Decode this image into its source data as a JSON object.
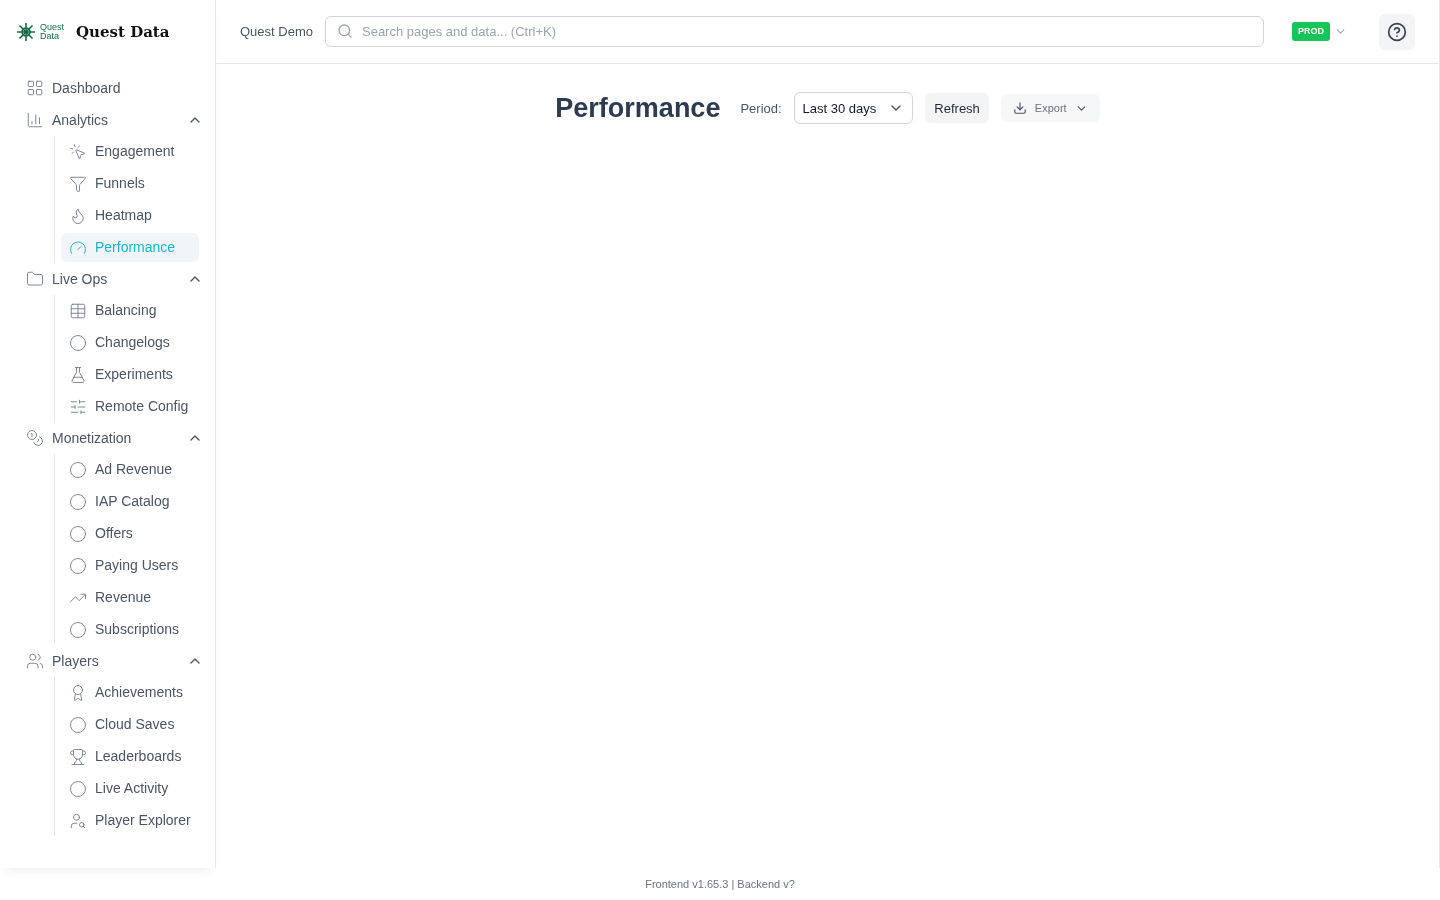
{
  "brand": {
    "logo_text": [
      "Quest",
      "Data"
    ],
    "name": "Quest Data"
  },
  "nav": [
    {
      "label": "Dashboard",
      "selected": false
    },
    {
      "label": "Analytics",
      "expanded": true,
      "children": [
        {
          "label": "Engagement",
          "selected": false
        },
        {
          "label": "Funnels",
          "selected": false
        },
        {
          "label": "Heatmap",
          "selected": false
        },
        {
          "label": "Performance",
          "selected": true
        }
      ]
    },
    {
      "label": "Live Ops",
      "expanded": true,
      "children": [
        {
          "label": "Balancing",
          "selected": false
        },
        {
          "label": "Changelogs",
          "selected": false
        },
        {
          "label": "Experiments",
          "selected": false
        },
        {
          "label": "Remote Config",
          "selected": false
        }
      ]
    },
    {
      "label": "Monetization",
      "expanded": true,
      "children": [
        {
          "label": "Ad Revenue",
          "selected": false
        },
        {
          "label": "IAP Catalog",
          "selected": false
        },
        {
          "label": "Offers",
          "selected": false
        },
        {
          "label": "Paying Users",
          "selected": false
        },
        {
          "label": "Revenue",
          "selected": false
        },
        {
          "label": "Subscriptions",
          "selected": false
        }
      ]
    },
    {
      "label": "Players",
      "expanded": true,
      "children": [
        {
          "label": "Achievements",
          "selected": false
        },
        {
          "label": "Cloud Saves",
          "selected": false
        },
        {
          "label": "Leaderboards",
          "selected": false
        },
        {
          "label": "Live Activity",
          "selected": false
        },
        {
          "label": "Player Explorer",
          "selected": false
        }
      ]
    }
  ],
  "header": {
    "project": "Quest Demo",
    "search": {
      "placeholder": "Search pages and data... (Ctrl+K)"
    },
    "environment": "PROD"
  },
  "page": {
    "title": "Performance",
    "period_label": "Period:",
    "period_value": "Last 30 days",
    "refresh": "Refresh",
    "export": "Export"
  },
  "footer": "Frontend v1.65.3 | Backend v?"
}
